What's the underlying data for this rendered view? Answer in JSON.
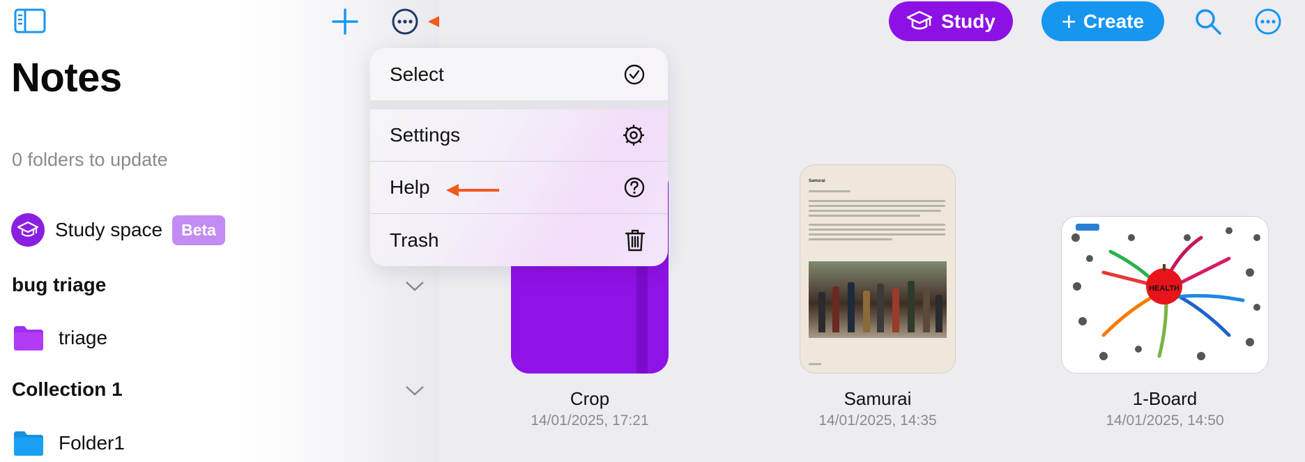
{
  "colors": {
    "accent_blue": "#1696ef",
    "study_purple": "#8d11e5",
    "annotation_arrow": "#f15a1d",
    "folder_purple": "#a12df0",
    "folder_blue": "#1aa0f2"
  },
  "toolbar": {
    "sidebar_icon": "sidebar-icon",
    "add_icon": "plus-icon",
    "more_icon": "ellipsis-circle-icon",
    "study_label": "Study",
    "create_label": "Create",
    "search_icon": "search-icon"
  },
  "sidebar": {
    "title": "Notes",
    "folders_to_update": "0 folders to update",
    "study_space": {
      "label": "Study space",
      "badge": "Beta"
    },
    "sections": [
      {
        "title": "bug triage",
        "folders": [
          {
            "label": "triage",
            "color": "#a12df0"
          }
        ]
      },
      {
        "title": "Collection 1",
        "folders": [
          {
            "label": "Folder1",
            "color": "#1aa0f2"
          }
        ]
      }
    ]
  },
  "menu": {
    "items": [
      {
        "label": "Select",
        "icon": "checkmark-circle-icon"
      },
      {
        "label": "Settings",
        "icon": "gear-icon"
      },
      {
        "label": "Help",
        "icon": "question-circle-icon"
      },
      {
        "label": "Trash",
        "icon": "trash-icon"
      }
    ]
  },
  "notes": [
    {
      "title": "Crop",
      "date": "14/01/2025, 17:21"
    },
    {
      "title": "Samurai",
      "date": "14/01/2025, 14:35",
      "doc_title": "Samurai"
    },
    {
      "title": "1-Board",
      "date": "14/01/2025, 14:50",
      "center_label": "HEALTH"
    }
  ]
}
